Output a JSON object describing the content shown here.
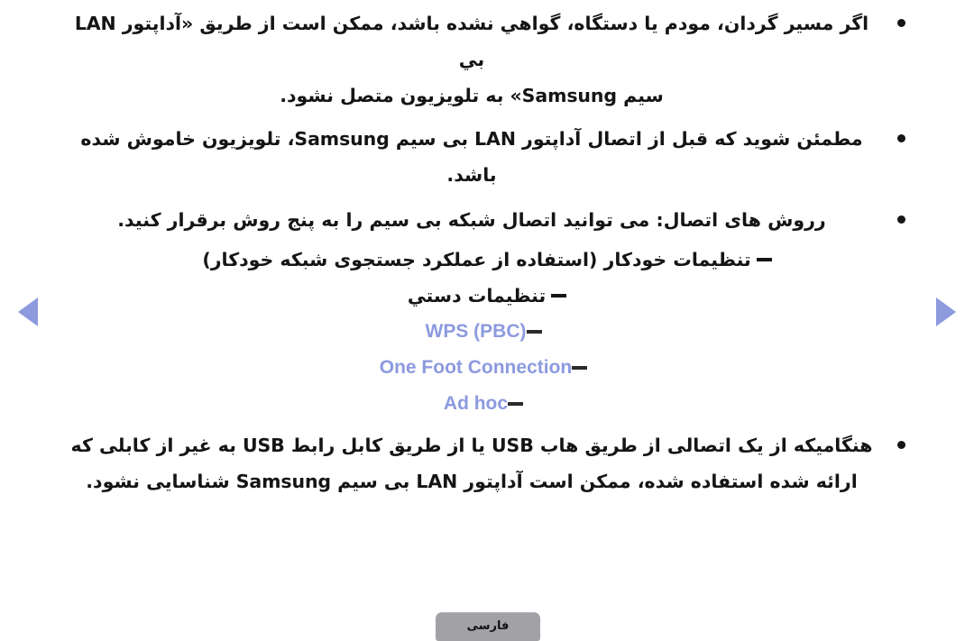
{
  "page": {
    "background_color": "#ffffff",
    "text_color": "#151515",
    "accent_color": "#8c9ade"
  },
  "nav": {
    "prev_label": "◀",
    "next_label": "▶"
  },
  "bullets": [
    {
      "id": "router-certification-note",
      "lines": [
        "اگر مسیر گردان، مودم یا دستگاه، گواهي نشده باشد، ممکن است از طریق «آداپتور LAN بي",
        "سیم Samsung» به تلویزیون متصل نشود."
      ]
    },
    {
      "id": "power-off-before-connect-note",
      "lines": [
        "مطمئن شوید که قبل از اتصال آداپتور LAN بی سیم Samsung، تلویزیون خاموش شده",
        "باشد."
      ]
    },
    {
      "id": "connection-methods-note",
      "lines": [
        "رروش های اتصال: می توانید اتصال شبکه بی سیم را به پنج روش برقرار کنید."
      ]
    },
    {
      "id": "usb-hub-note",
      "lines": [
        "هنگامیکه از یک اتصالی از طریق هاب USB یا از طریق کابل رابط USB به غیر از کابلی که",
        "ارائه شده استفاده شده، ممکن است آداپتور LAN بی سیم Samsung شناسایی نشود."
      ]
    }
  ],
  "connection_methods": [
    {
      "id": "auto-setup",
      "label": "تنظیمات خودکار (استفاده از عملکرد جستجوی شبکه خودکار)",
      "style": "rtl"
    },
    {
      "id": "manual-setup",
      "label": "تنظیمات دستي",
      "style": "rtl"
    },
    {
      "id": "wps-pbc",
      "label": "WPS (PBC)",
      "style": "latin"
    },
    {
      "id": "one-foot-connection",
      "label": "One Foot Connection",
      "style": "latin"
    },
    {
      "id": "ad-hoc",
      "label": "Ad hoc",
      "style": "latin"
    }
  ],
  "footer": {
    "language_button_label": "فارسی"
  }
}
